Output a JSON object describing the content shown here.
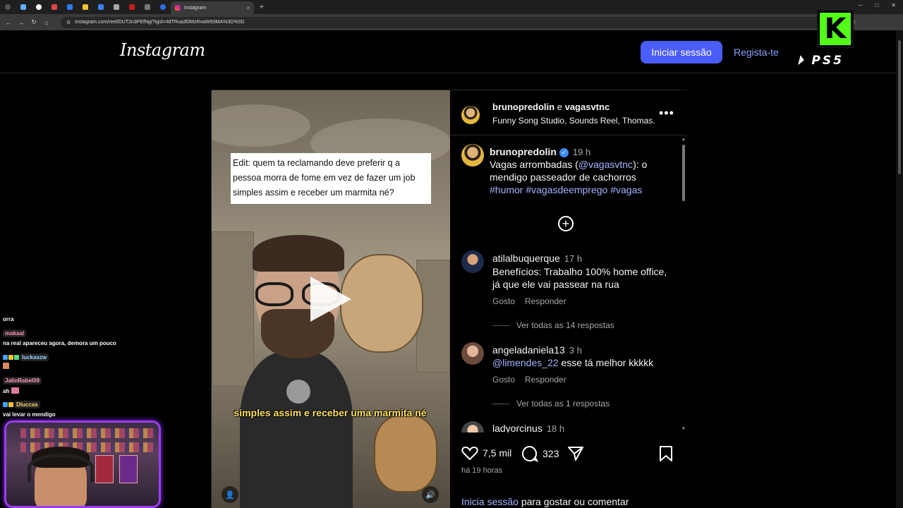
{
  "browser": {
    "tab_title": "Instagram",
    "url": "instagram.com/reel/DUT2n3PEfNg/?igsh=MTRua3l0MzRnaW93MA%3D%3D",
    "new_tab_symbol": "+",
    "close_symbol": "×"
  },
  "header": {
    "logo": "Instagram",
    "login_label": "Iniciar sessão",
    "signup_label": "Regista-te"
  },
  "overlay": {
    "kick_letter": "K",
    "ps5_label": "PS5"
  },
  "video": {
    "caption_box": "Edit: quem ta reclamando deve preferir q a pessoa morra de fome em vez de fazer um job simples assim e receber um marmita né?",
    "subtitle": "simples assim e receber uma marmita né"
  },
  "post": {
    "author1": "brunopredolin",
    "and_word": "e",
    "author2": "vagasvtnc",
    "audio": "Funny Song Studio, Sounds Reel, Thomas...",
    "caption_user": "brunopredolin",
    "caption_time": "19 h",
    "caption_text_1": "Vagas arrombadas (",
    "caption_mention": "@vagasvtnc",
    "caption_text_2": "): o mendigo passeador de cachorros",
    "caption_tags": "#humor #vagasdeemprego #vagas"
  },
  "comments": [
    {
      "user": "atilalbuquerque",
      "time": "17 h",
      "text": "Benefícios: Trabalho 100% home office, já que ele vai passear na rua",
      "like": "Gosto",
      "reply": "Responder",
      "replies": "Ver todas as 14 respostas"
    },
    {
      "user": "angeladaniela13",
      "time": "3 h",
      "mention": "@limendes_22",
      "text": " esse tá melhor kkkkk",
      "like": "Gosto",
      "reply": "Responder",
      "replies": "Ver todas as 1 respostas"
    },
    {
      "user": "ladyorcinus",
      "time": "18 h"
    }
  ],
  "actions": {
    "likes": "7,5 mil",
    "comments": "323",
    "ago": "há 19 horas",
    "login_link": "Inicia sessão",
    "login_rest": " para gostar ou comentar"
  },
  "chat": [
    {
      "user": "",
      "text": "orra"
    },
    {
      "user": "makaal",
      "text": ""
    },
    {
      "user": "",
      "text": "na real apareceu agora, demora um pouco"
    },
    {
      "user": "luckaszw",
      "text": ""
    },
    {
      "user": "JalinRabel09",
      "text": ""
    },
    {
      "user": "",
      "text": "ah"
    },
    {
      "user": "Dluccas",
      "text": ""
    },
    {
      "user": "",
      "text": "vai levar o mendigo"
    }
  ],
  "colors": {
    "accent": "#4a5df9",
    "link": "#a4b4ff",
    "kick_green": "#53fc18",
    "webcam_border": "#9b3cf0"
  }
}
